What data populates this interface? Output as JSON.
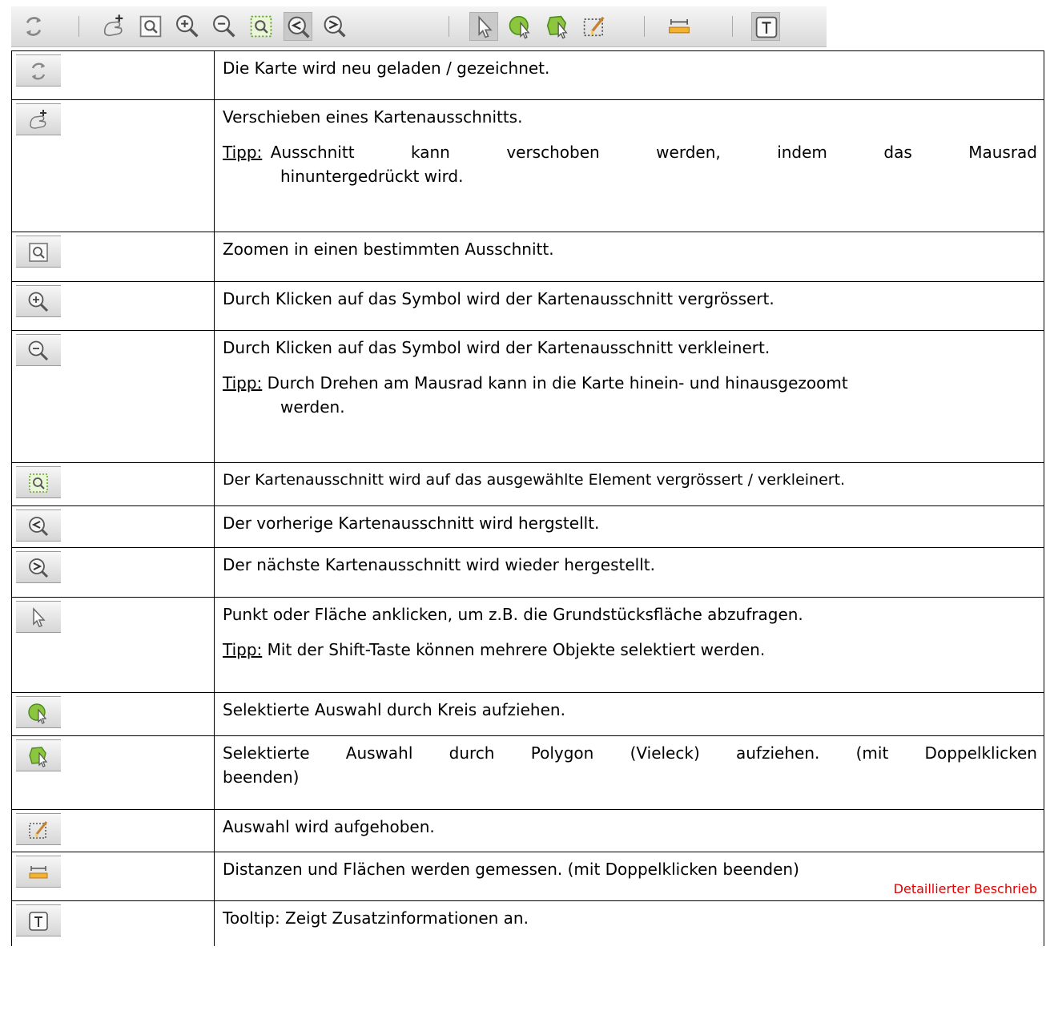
{
  "toolbar": {
    "items": [
      "refresh-icon",
      "pan-icon",
      "zoom-box-icon",
      "zoom-in-icon",
      "zoom-out-icon",
      "zoom-to-selection-icon",
      "previous-extent-icon",
      "next-extent-icon",
      "select-icon",
      "select-circle-icon",
      "select-polygon-icon",
      "clear-selection-icon",
      "measure-icon",
      "tooltip-icon"
    ]
  },
  "rows": [
    {
      "icon": "refresh-icon",
      "text": "Die Karte wird neu geladen / gezeichnet."
    },
    {
      "icon": "pan-icon",
      "text": "Verschieben eines Kartenausschnitts.",
      "tip_label": "Tipp:",
      "tip_first": "Ausschnitt kann verschoben werden, indem das Mausrad",
      "tip_rest": "hinuntergedrückt wird."
    },
    {
      "icon": "zoom-box-icon",
      "text": "Zoomen in einen bestimmten Ausschnitt."
    },
    {
      "icon": "zoom-in-icon",
      "text": "Durch Klicken auf das Symbol wird der Kartenausschnitt vergrössert."
    },
    {
      "icon": "zoom-out-icon",
      "text": "Durch Klicken auf das Symbol wird der Kartenausschnitt verkleinert.",
      "tip_label": "Tipp:",
      "tip_first": "Durch Drehen am Mausrad kann in die Karte hinein- und hinausgezoomt",
      "tip_rest": "werden."
    },
    {
      "icon": "zoom-to-selection-icon",
      "text": "Der Kartenausschnitt wird auf das ausgewählte Element vergrössert / verkleinert."
    },
    {
      "icon": "previous-extent-icon",
      "text": "Der vorherige Kartenausschnitt wird hergstellt."
    },
    {
      "icon": "next-extent-icon",
      "text": "Der nächste Kartenausschnitt wird wieder hergestellt."
    },
    {
      "icon": "select-icon",
      "text": "Punkt oder Fläche anklicken, um z.B. die Grundstücksfläche abzufragen.",
      "tip_label": "Tipp:",
      "tip_first": "Mit der Shift-Taste können mehrere Objekte selektiert werden."
    },
    {
      "icon": "select-circle-icon",
      "text": "Selektierte Auswahl durch Kreis aufziehen."
    },
    {
      "icon": "select-polygon-icon",
      "text": "Selektierte Auswahl durch Polygon (Vieleck) aufziehen. (mit Doppelklicken",
      "text2": "beenden)"
    },
    {
      "icon": "clear-selection-icon",
      "text": "Auswahl wird aufgehoben."
    },
    {
      "icon": "measure-icon",
      "text": "Distanzen und Flächen werden gemessen. (mit Doppelklicken beenden)",
      "link": "Detaillierter Beschrieb"
    },
    {
      "icon": "tooltip-icon",
      "text": "Tooltip: Zeigt Zusatzinformationen an."
    }
  ]
}
